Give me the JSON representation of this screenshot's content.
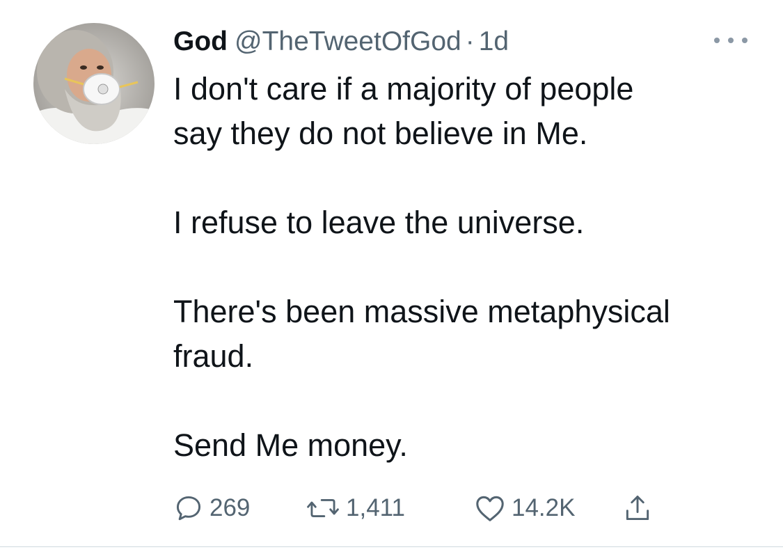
{
  "tweet": {
    "author_name": "God",
    "author_handle": "@TheTweetOfGod",
    "separator": "·",
    "time_ago": "1d",
    "lines": {
      "l1": "I don't care if a majority of people",
      "l2": "say they do not believe in Me.",
      "l3": "I refuse to leave the universe.",
      "l4": "There's been massive metaphysical",
      "l5": "fraud.",
      "l6": "Send Me money."
    },
    "stats": {
      "replies": "269",
      "retweets": "1,411",
      "likes": "14.2K"
    }
  },
  "icons": {
    "more": "more-horizontal-icon",
    "reply": "reply-bubble-icon",
    "retweet": "retweet-icon",
    "like": "heart-icon",
    "share": "share-upload-icon"
  },
  "colors": {
    "text_primary": "#0f1419",
    "text_secondary": "#536471",
    "icon_gray": "#536471",
    "background": "#ffffff"
  }
}
